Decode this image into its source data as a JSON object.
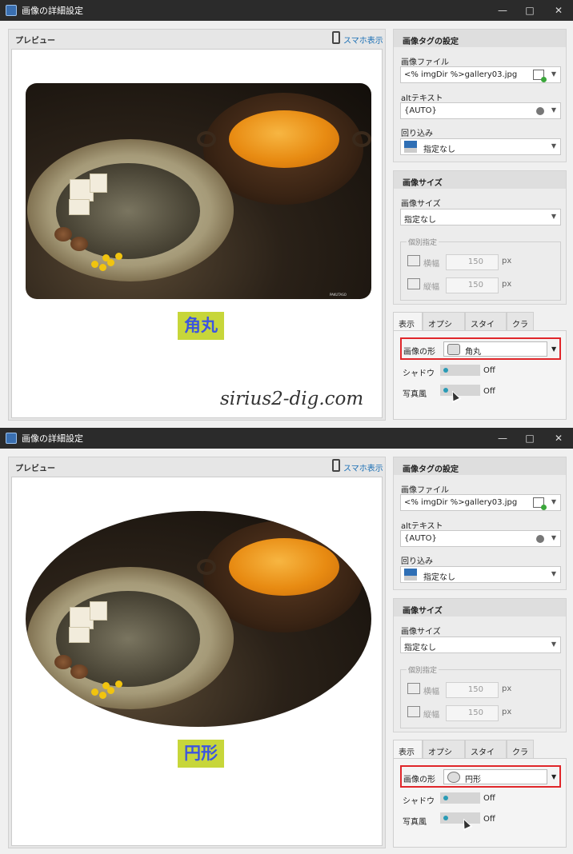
{
  "windows": [
    {
      "title": "画像の詳細設定",
      "preview_label": "プレビュー",
      "smartphone_link": "スマホ表示",
      "photo_credit": "PAKUTASO",
      "caption": "角丸",
      "watermark": "sirius2-dig.com",
      "tag_settings": {
        "header": "画像タグの設定",
        "file_label": "画像ファイル",
        "file_value": "<% imgDir %>gallery03.jpg",
        "alt_label": "altテキスト",
        "alt_value": "{AUTO}",
        "wrap_label": "回り込み",
        "wrap_value": "指定なし"
      },
      "size_settings": {
        "header": "画像サイズ",
        "size_label": "画像サイズ",
        "size_value": "指定なし",
        "individual_label": "個別指定",
        "width_label": "横幅",
        "width_value": "150",
        "height_label": "縦幅",
        "height_value": "150",
        "unit": "px"
      },
      "tabs": [
        "表示",
        "オプション",
        "スタイル",
        "クラス"
      ],
      "shape_label": "画像の形",
      "shape_value": "角丸",
      "shadow_label": "シャドウ",
      "shadow_value": "Off",
      "photo_label": "写真風",
      "photo_value": "Off"
    },
    {
      "title": "画像の詳細設定",
      "preview_label": "プレビュー",
      "smartphone_link": "スマホ表示",
      "caption": "円形",
      "tag_settings": {
        "header": "画像タグの設定",
        "file_label": "画像ファイル",
        "file_value": "<% imgDir %>gallery03.jpg",
        "alt_label": "altテキスト",
        "alt_value": "{AUTO}",
        "wrap_label": "回り込み",
        "wrap_value": "指定なし"
      },
      "size_settings": {
        "header": "画像サイズ",
        "size_label": "画像サイズ",
        "size_value": "指定なし",
        "individual_label": "個別指定",
        "width_label": "横幅",
        "width_value": "150",
        "height_label": "縦幅",
        "height_value": "150",
        "unit": "px"
      },
      "tabs": [
        "表示",
        "オプション",
        "スタイル",
        "クラス"
      ],
      "shape_label": "画像の形",
      "shape_value": "円形",
      "shadow_label": "シャドウ",
      "shadow_value": "Off",
      "photo_label": "写真風",
      "photo_value": "Off"
    }
  ],
  "colors": {
    "highlight": "#e0262a",
    "caption_bg": "#c7d63a",
    "caption_text": "#3c55e0",
    "toggle_knob": "#2a9bb5"
  }
}
